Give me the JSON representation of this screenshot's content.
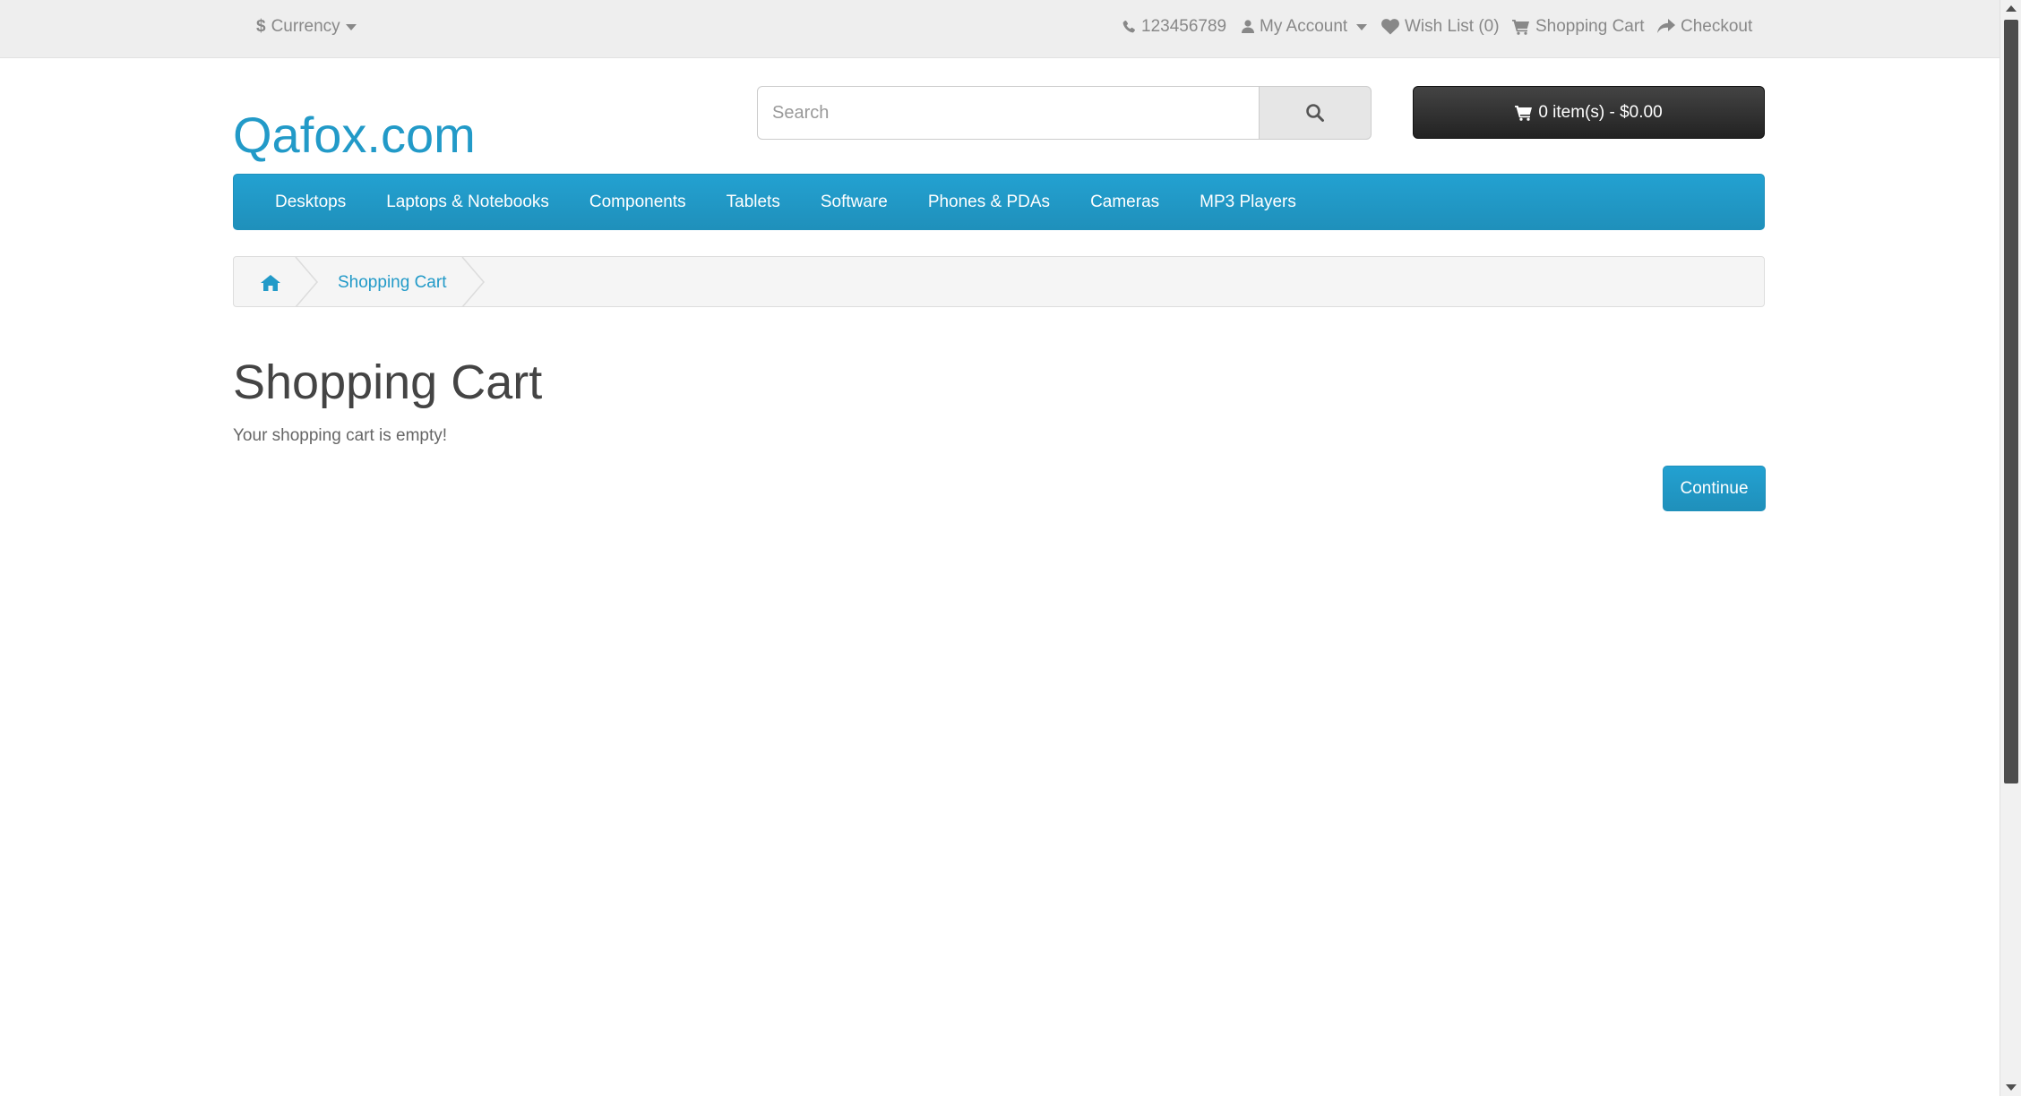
{
  "topbar": {
    "currency_symbol": "$",
    "currency_label": "Currency",
    "phone": "123456789",
    "my_account": "My Account",
    "wish_list": "Wish List (0)",
    "shopping_cart": "Shopping Cart",
    "checkout": "Checkout"
  },
  "header": {
    "logo": "Qafox.com",
    "search_placeholder": "Search",
    "cart_summary": "0 item(s) - $0.00"
  },
  "menu": {
    "items": [
      "Desktops",
      "Laptops & Notebooks",
      "Components",
      "Tablets",
      "Software",
      "Phones & PDAs",
      "Cameras",
      "MP3 Players"
    ]
  },
  "breadcrumb": {
    "current": "Shopping Cart"
  },
  "content": {
    "title": "Shopping Cart",
    "empty_message": "Your shopping cart is empty!",
    "continue_label": "Continue"
  },
  "colors": {
    "accent": "#229ac8",
    "topbar_bg": "#eeeeee",
    "cart_button_bg": "#222222"
  },
  "icons": [
    "phone-icon",
    "user-icon",
    "heart-icon",
    "cart-icon",
    "share-icon",
    "search-icon",
    "home-icon"
  ]
}
